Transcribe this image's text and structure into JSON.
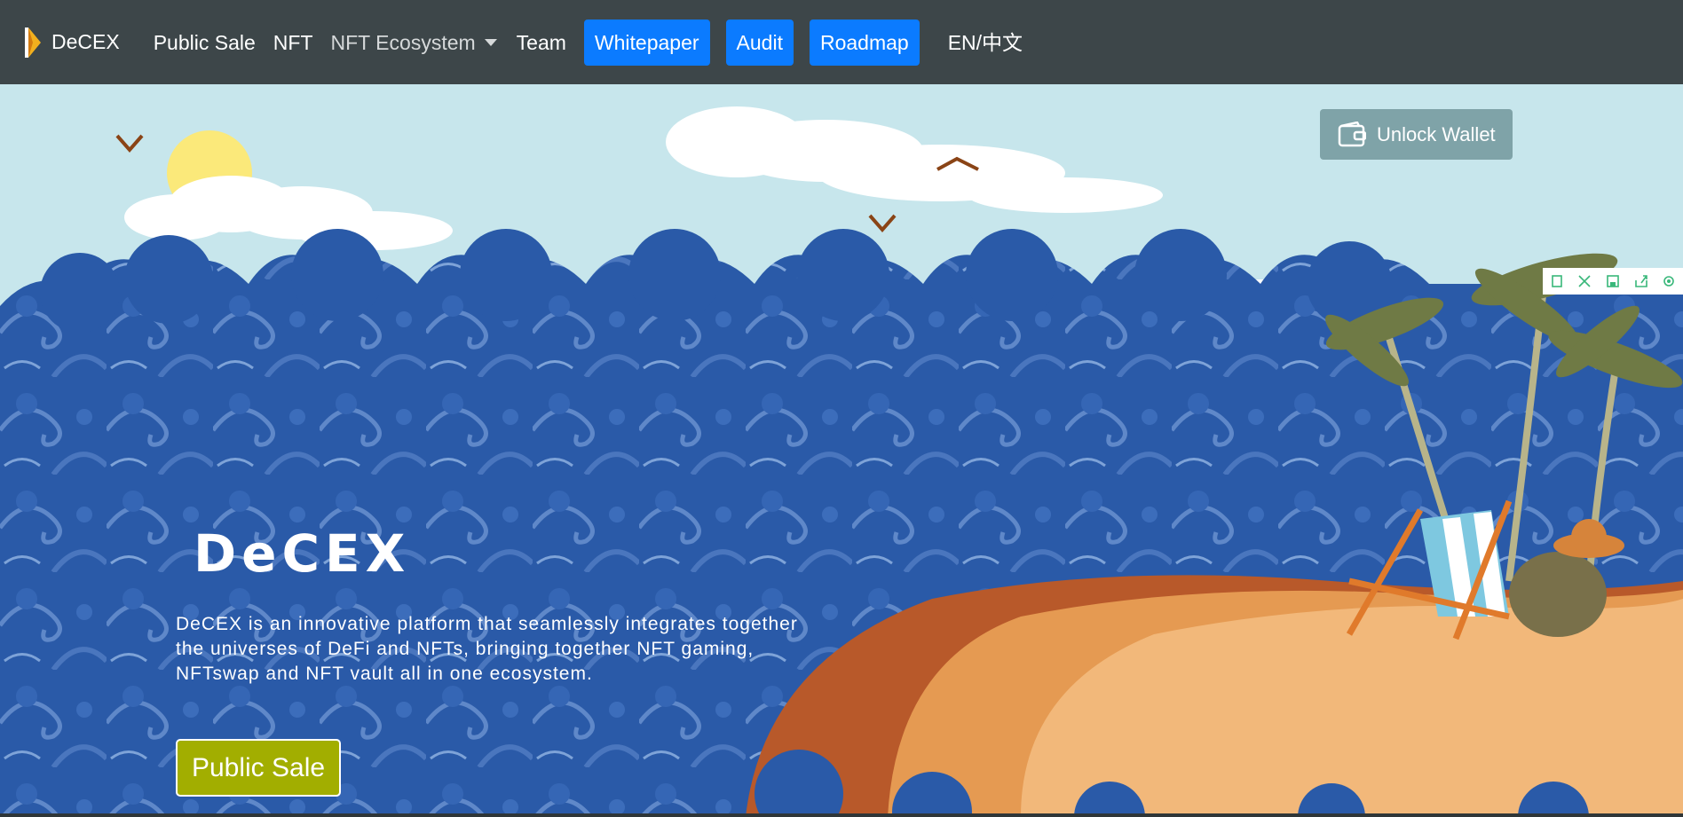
{
  "navbar": {
    "brand": "DeCEX",
    "links": {
      "public_sale": "Public Sale",
      "nft": "NFT",
      "nft_ecosystem": "NFT Ecosystem",
      "team": "Team",
      "whitepaper": "Whitepaper",
      "audit": "Audit",
      "roadmap": "Roadmap",
      "language": "EN/中文"
    },
    "colors": {
      "background": "#3d4649",
      "button": "#0b7bff"
    }
  },
  "hero": {
    "wallet_button": "Unlock Wallet",
    "title": "DeCEX",
    "description": "DeCEX is an innovative platform that seamlessly integrates together the universes of DeFi and NFTs, bringing together NFT gaming, NFTswap and NFT vault all in one ecosystem.",
    "cta": "Public Sale",
    "colors": {
      "sky": "#c7e6ec",
      "waves": "#2f5fb0",
      "sand": "#f0b573",
      "cta": "#a2ae00"
    }
  },
  "toolbar_icons": [
    "fit-icon",
    "expand-icon",
    "save-icon",
    "share-icon",
    "settings-icon"
  ]
}
